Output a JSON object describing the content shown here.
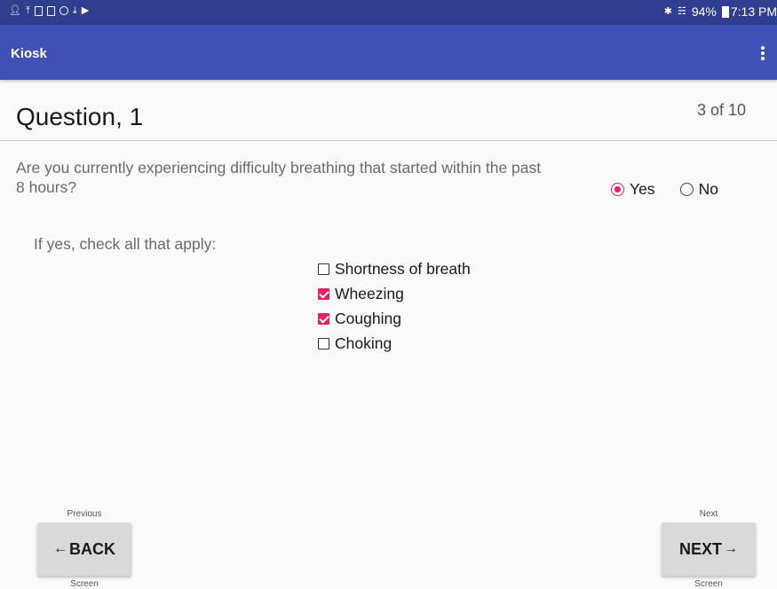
{
  "status_bar": {
    "battery": "94%",
    "time": "7:13 PM",
    "left_icons": [
      "person-icon",
      "upload-icon",
      "image-icon",
      "gallery-icon",
      "target-icon",
      "download-icon",
      "play-icon"
    ],
    "right_icons": [
      "bluetooth-icon",
      "wifi-icon",
      "battery-icon"
    ]
  },
  "app_bar": {
    "title": "Kiosk",
    "menu_icon": "overflow-menu-icon"
  },
  "page": {
    "title": "Question, 1",
    "counter": "3 of 10"
  },
  "question": {
    "text": "Are you currently experiencing difficulty breathing that started within the past 8 hours?",
    "options": [
      {
        "label": "Yes",
        "selected": true
      },
      {
        "label": "No",
        "selected": false
      }
    ]
  },
  "follow_up": {
    "instruction": "If yes, check all that apply:",
    "items": [
      {
        "label": "Shortness of breath",
        "checked": false
      },
      {
        "label": "Wheezing",
        "checked": true
      },
      {
        "label": "Coughing",
        "checked": true
      },
      {
        "label": "Choking",
        "checked": false
      }
    ]
  },
  "nav": {
    "back": {
      "label": "BACK",
      "top_hint": "Previous",
      "bottom_hint": "Screen"
    },
    "next": {
      "label": "NEXT",
      "top_hint": "Next",
      "bottom_hint": "Screen"
    }
  },
  "colors": {
    "status_bar": "#2f3e8f",
    "app_bar": "#3f51b5",
    "accent": "#e91e63",
    "background": "#fafafa",
    "button": "#d9d9d9"
  }
}
